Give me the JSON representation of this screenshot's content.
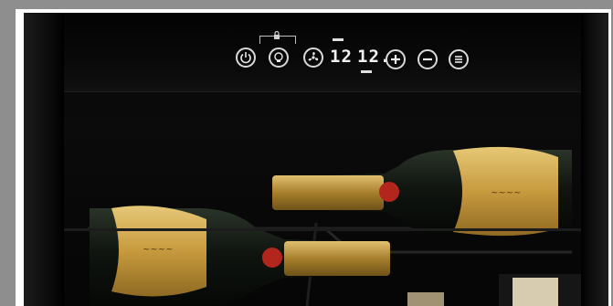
{
  "display": {
    "left_temp": "12",
    "right_temp": "12."
  },
  "controls": {
    "power": "power-icon",
    "light": "light-icon",
    "lock": "lock-icon",
    "fan": "fan-icon",
    "plus": "plus-icon",
    "minus": "minus-icon",
    "menu": "menu-icon"
  },
  "colors": {
    "display_text": "#f2f2f2",
    "gold_label": "#c9a14a",
    "red_seal": "#b3261e",
    "bottle_glass": "#121a12"
  }
}
